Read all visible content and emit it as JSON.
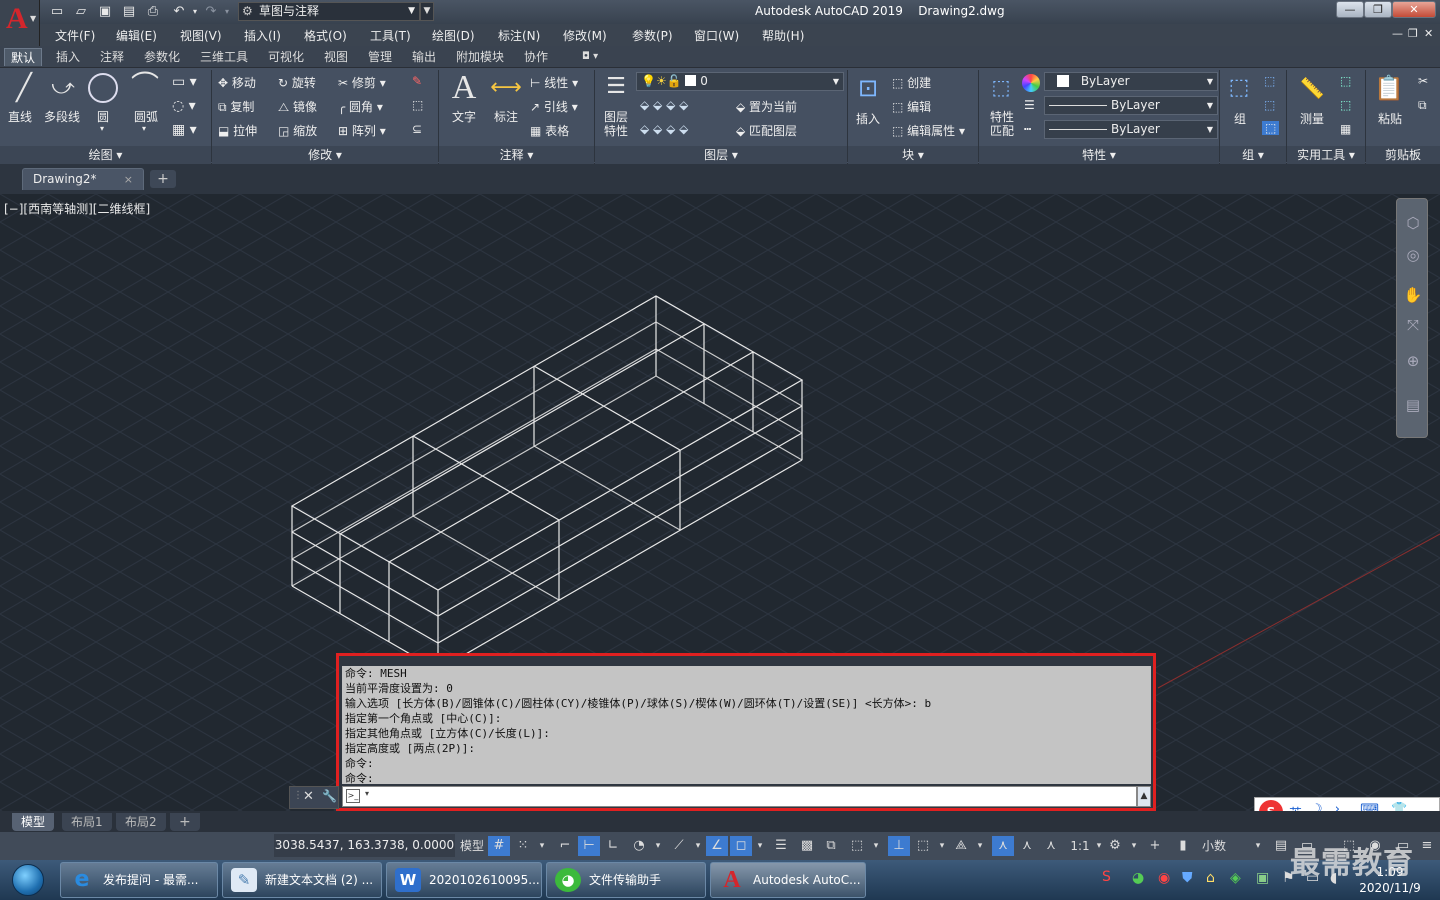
{
  "app": {
    "title": "Autodesk AutoCAD 2019",
    "document": "Drawing2.dwg",
    "logo": "A",
    "workspace": "草图与注释"
  },
  "quick_access": [
    "new-icon",
    "open-icon",
    "save-icon",
    "save-as-icon",
    "print-icon",
    "undo-icon",
    "redo-icon"
  ],
  "window_controls": {
    "minimize": "—",
    "restore": "❐",
    "close": "✕"
  },
  "menu": [
    "文件(F)",
    "编辑(E)",
    "视图(V)",
    "插入(I)",
    "格式(O)",
    "工具(T)",
    "绘图(D)",
    "标注(N)",
    "修改(M)",
    "参数(P)",
    "窗口(W)",
    "帮助(H)"
  ],
  "ribbon_tabs": [
    "默认",
    "插入",
    "注释",
    "参数化",
    "三维工具",
    "可视化",
    "视图",
    "管理",
    "输出",
    "附加模块",
    "协作"
  ],
  "ribbon": {
    "draw": {
      "line": "直线",
      "polyline": "多段线",
      "circle": "圆",
      "arc": "圆弧",
      "title": "绘图"
    },
    "modify": {
      "move": "移动",
      "rotate": "旋转",
      "trim": "修剪",
      "copy": "复制",
      "mirror": "镜像",
      "fillet": "圆角",
      "stretch": "拉伸",
      "scale": "缩放",
      "array": "阵列",
      "title": "修改"
    },
    "annotation": {
      "text": "文字",
      "dimension": "标注",
      "linear": "线性",
      "leader": "引线",
      "table": "表格",
      "title": "注释"
    },
    "layers": {
      "props_1": "图层",
      "props_2": "特性",
      "current_layer": "0",
      "set_current": "置为当前",
      "match_layer": "匹配图层",
      "title": "图层"
    },
    "block": {
      "insert": "插入",
      "create": "创建",
      "edit": "编辑",
      "edit_attr": "编辑属性",
      "title": "块"
    },
    "properties": {
      "match_1": "特性",
      "match_2": "匹配",
      "color": "ByLayer",
      "linetype": "ByLayer",
      "lineweight": "ByLayer",
      "title": "特性"
    },
    "groups": {
      "group": "组",
      "title": "组"
    },
    "utilities": {
      "measure": "测量",
      "title": "实用工具"
    },
    "clipboard": {
      "paste": "粘贴",
      "title": "剪贴板"
    }
  },
  "doc_tab": {
    "name": "Drawing2*",
    "close": "×",
    "add": "+"
  },
  "viewport_label": "[−][西南等轴测][二维线框]",
  "command_history": [
    "命令: MESH",
    "当前平滑度设置为: 0",
    "输入选项 [长方体(B)/圆锥体(C)/圆柱体(CY)/棱锥体(P)/球体(S)/楔体(W)/圆环体(T)/设置(SE)] <长方体>: b",
    "指定第一个角点或 [中心(C)]:",
    "指定其他角点或 [立方体(C)/长度(L)]:",
    "指定高度或 [两点(2P)]:",
    "命令:",
    "命令:"
  ],
  "layout_tabs": [
    "模型",
    "布局1",
    "布局2"
  ],
  "status": {
    "coords": "3038.5437, 163.3738, 0.0000",
    "model": "模型",
    "scale": "1:1",
    "units": "小数"
  },
  "taskbar": [
    {
      "label": "发布提问 - 最需...",
      "icon": "ie-icon",
      "color": "#2a8be0"
    },
    {
      "label": "新建文本文档 (2) ...",
      "icon": "notepad-icon",
      "color": "#7fb1d9"
    },
    {
      "label": "2020102610095...",
      "icon": "word-icon",
      "color": "#2f6fcc"
    },
    {
      "label": "文件传输助手",
      "icon": "wechat-icon",
      "color": "#3cba3c"
    },
    {
      "label": "Autodesk AutoC...",
      "icon": "autocad-icon",
      "color": "#d4262c"
    }
  ],
  "ime": {
    "lang": "英"
  },
  "clock": {
    "time": "1:09",
    "date": "2020/11/9"
  },
  "watermark": "最需教育"
}
